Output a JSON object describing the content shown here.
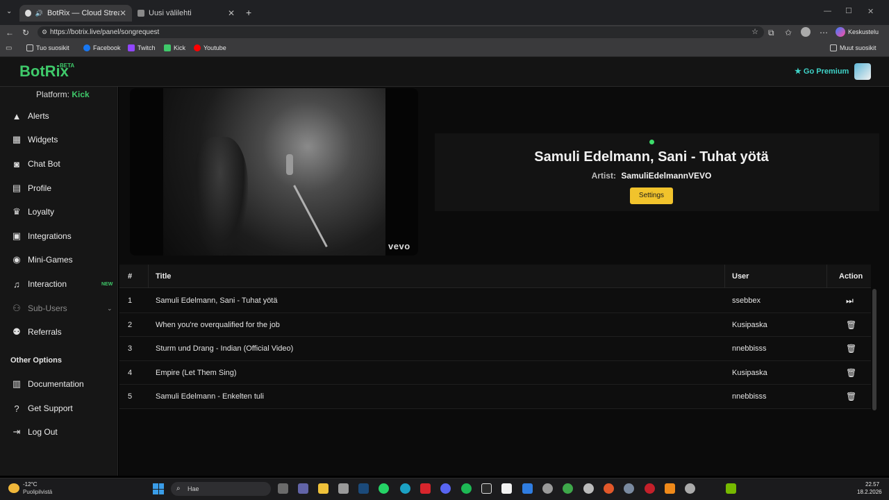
{
  "browser": {
    "tabs": [
      {
        "label": "BotRix — Cloud Streaming Bo"
      },
      {
        "label": "Uusi välilehti"
      }
    ],
    "new_tab": "+",
    "url": "https://botrix.live/panel/songrequest",
    "profile_label": "Keskustelu",
    "bookmarks": [
      {
        "label": "Tuo suosikit"
      },
      {
        "label": "Facebook",
        "color": "#1877f2"
      },
      {
        "label": "Twitch",
        "color": "#9146ff"
      },
      {
        "label": "Kick",
        "color": "#3fc96a"
      },
      {
        "label": "Youtube",
        "color": "#ff0000"
      }
    ],
    "other_bookmarks": "Muut suosikit"
  },
  "app": {
    "logo": "BotRix",
    "logo_badge": "BETA",
    "premium": "★ Go Premium",
    "platform_label": "Platform:",
    "platform_value": "Kick",
    "accent": "#3fc96a"
  },
  "sidebar": {
    "items": [
      {
        "label": "Alerts",
        "icon": "warning-icon"
      },
      {
        "label": "Widgets",
        "icon": "grid-icon"
      },
      {
        "label": "Chat Bot",
        "icon": "robot-icon"
      },
      {
        "label": "Profile",
        "icon": "id-card-icon"
      },
      {
        "label": "Loyalty",
        "icon": "trophy-icon"
      },
      {
        "label": "Integrations",
        "icon": "plug-icon"
      },
      {
        "label": "Mini-Games",
        "icon": "gamepad-icon"
      },
      {
        "label": "Interaction",
        "icon": "music-icon",
        "badge": "NEW"
      },
      {
        "label": "Sub-Users",
        "icon": "users-icon"
      },
      {
        "label": "Referrals",
        "icon": "people-icon"
      }
    ],
    "other_options_title": "Other Options",
    "other_items": [
      {
        "label": "Documentation",
        "icon": "book-icon"
      },
      {
        "label": "Get Support",
        "icon": "help-icon"
      },
      {
        "label": "Log Out",
        "icon": "logout-icon"
      }
    ]
  },
  "now_playing": {
    "video_watermark": "vevo",
    "title": "Samuli Edelmann, Sani - Tuhat yötä",
    "artist_label": "Artist:",
    "artist": "SamuliEdelmannVEVO",
    "settings_button": "Settings"
  },
  "queue": {
    "columns": [
      "#",
      "Title",
      "User",
      "Action"
    ],
    "rows": [
      {
        "num": "1",
        "title": "Samuli Edelmann, Sani - Tuhat yötä",
        "user": "ssebbex",
        "action": "skip-icon"
      },
      {
        "num": "2",
        "title": "When you're overqualified for the job",
        "user": "Kusipaska",
        "action": "trash-icon"
      },
      {
        "num": "3",
        "title": "Sturm und Drang - Indian (Official Video)",
        "user": "nnebbisss",
        "action": "trash-icon"
      },
      {
        "num": "4",
        "title": "Empire (Let Them Sing)",
        "user": "Kusipaska",
        "action": "trash-icon"
      },
      {
        "num": "5",
        "title": "Samuli Edelmann - Enkelten tuli",
        "user": "nnebbisss",
        "action": "trash-icon"
      }
    ]
  },
  "taskbar": {
    "weather_temp": "-12°C",
    "weather_desc": "Puolipilvistä",
    "search_placeholder": "Hae",
    "time": "22.57",
    "date": "18.2.2026"
  }
}
